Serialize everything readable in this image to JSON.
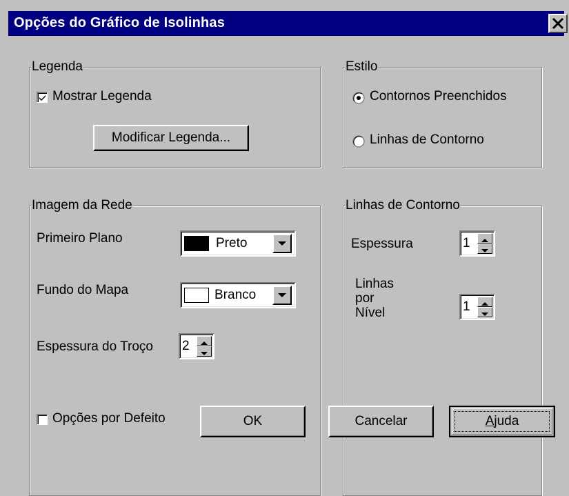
{
  "window": {
    "title": "Opções do Gráfico de Isolinhas",
    "close_glyph": "✕"
  },
  "legend_group": {
    "label": "Legenda",
    "show_legend_label": "Mostrar Legenda",
    "show_legend_checked": true,
    "modify_button": "Modificar Legenda..."
  },
  "style_group": {
    "label": "Estilo",
    "options": [
      "Contornos Preenchidos",
      "Linhas de Contorno"
    ],
    "selected": "Contornos Preenchidos"
  },
  "grid_image_group": {
    "label": "Imagem da Rede",
    "foreground_label": "Primeiro Plano",
    "foreground_value": "Preto",
    "foreground_color": "#000000",
    "background_label": "Fundo do Mapa",
    "background_value": "Branco",
    "background_color": "#ffffff",
    "stroke_label": "Espessura do Troço",
    "stroke_value": "2"
  },
  "contour_lines_group": {
    "label": "Linhas de Contorno",
    "thickness_label": "Espessura",
    "thickness_value": "1",
    "lines_per_level_label_1": "Linhas",
    "lines_per_level_label_2": "por",
    "lines_per_level_label_3": "Nível",
    "lines_per_level_value": "1"
  },
  "footer": {
    "default_options_label": "Opções por Defeito",
    "default_options_checked": false,
    "ok": "OK",
    "cancel": "Cancelar",
    "help": "Ajuda"
  },
  "colors": {
    "titlebar": "#000080",
    "face": "#c0c0c0"
  }
}
